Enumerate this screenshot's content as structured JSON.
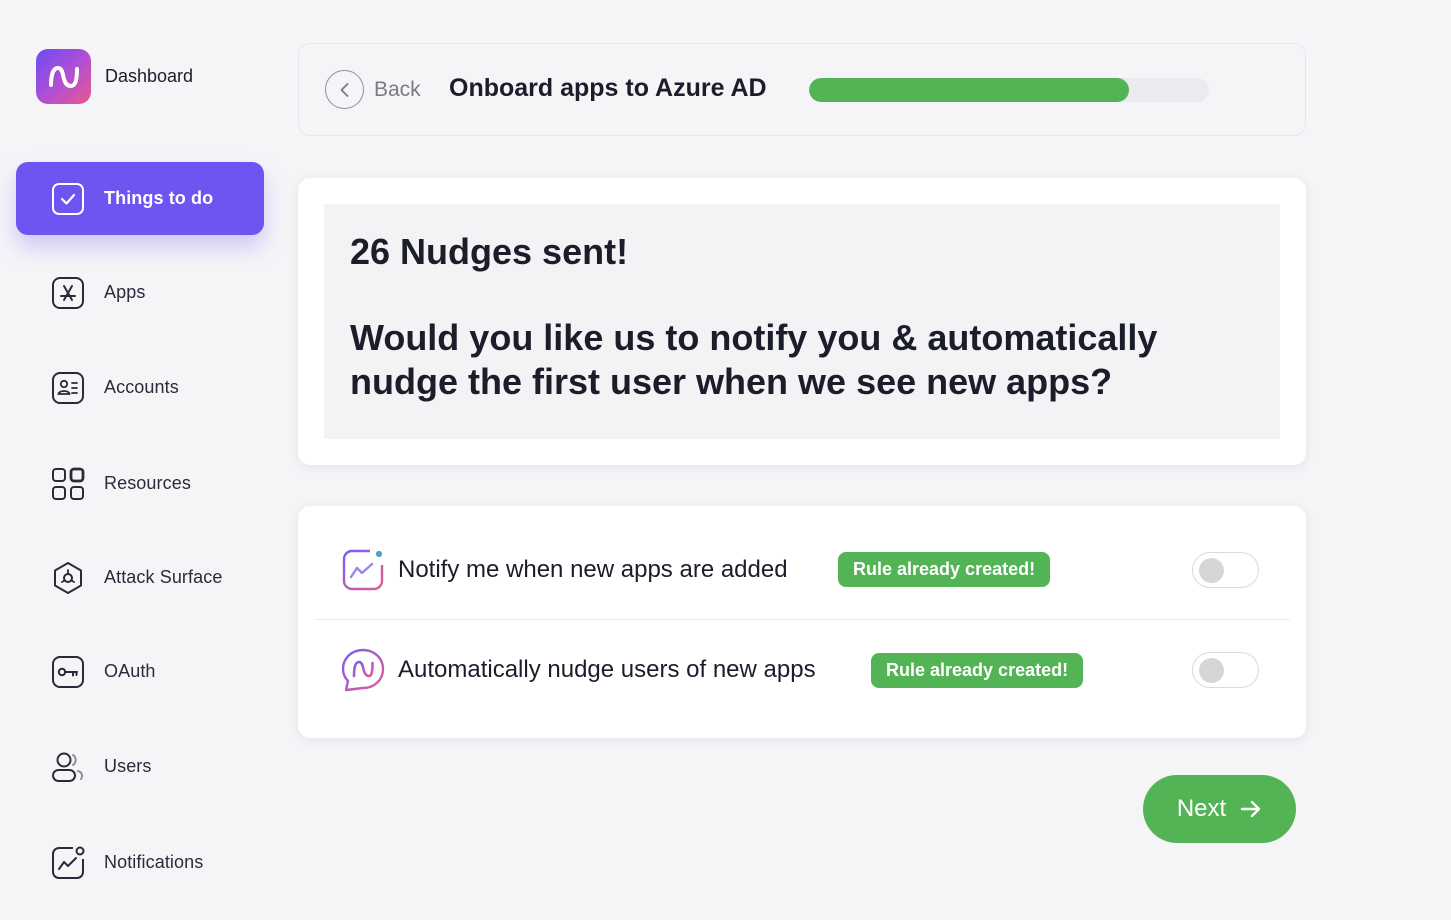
{
  "sidebar": {
    "brand_label": "Dashboard",
    "items": [
      {
        "label": "Things to do",
        "icon": "check-square-icon",
        "active": true
      },
      {
        "label": "Apps",
        "icon": "app-store-icon"
      },
      {
        "label": "Accounts",
        "icon": "id-card-icon"
      },
      {
        "label": "Resources",
        "icon": "grid-icon"
      },
      {
        "label": "Attack Surface",
        "icon": "hexagon-target-icon"
      },
      {
        "label": "OAuth",
        "icon": "key-icon"
      },
      {
        "label": "Users",
        "icon": "users-icon"
      },
      {
        "label": "Notifications",
        "icon": "chart-bell-icon"
      }
    ]
  },
  "header": {
    "back_label": "Back",
    "title": "Onboard apps to Azure AD",
    "progress_fraction": 0.8
  },
  "message": {
    "line1": "26 Nudges sent!",
    "line2": "Would you like us to notify you & automatically nudge the first user when we see new apps?"
  },
  "options": [
    {
      "label": "Notify me when new apps are added",
      "badge": "Rule already created!",
      "enabled": false,
      "icon": "notification-chart-icon"
    },
    {
      "label": "Automatically nudge users of new apps",
      "badge": "Rule already created!",
      "enabled": false,
      "icon": "nudge-chat-icon"
    }
  ],
  "footer": {
    "next_label": "Next"
  },
  "colors": {
    "accent": "#6f54f2",
    "success": "#52b455",
    "background": "#f5f5f8"
  }
}
